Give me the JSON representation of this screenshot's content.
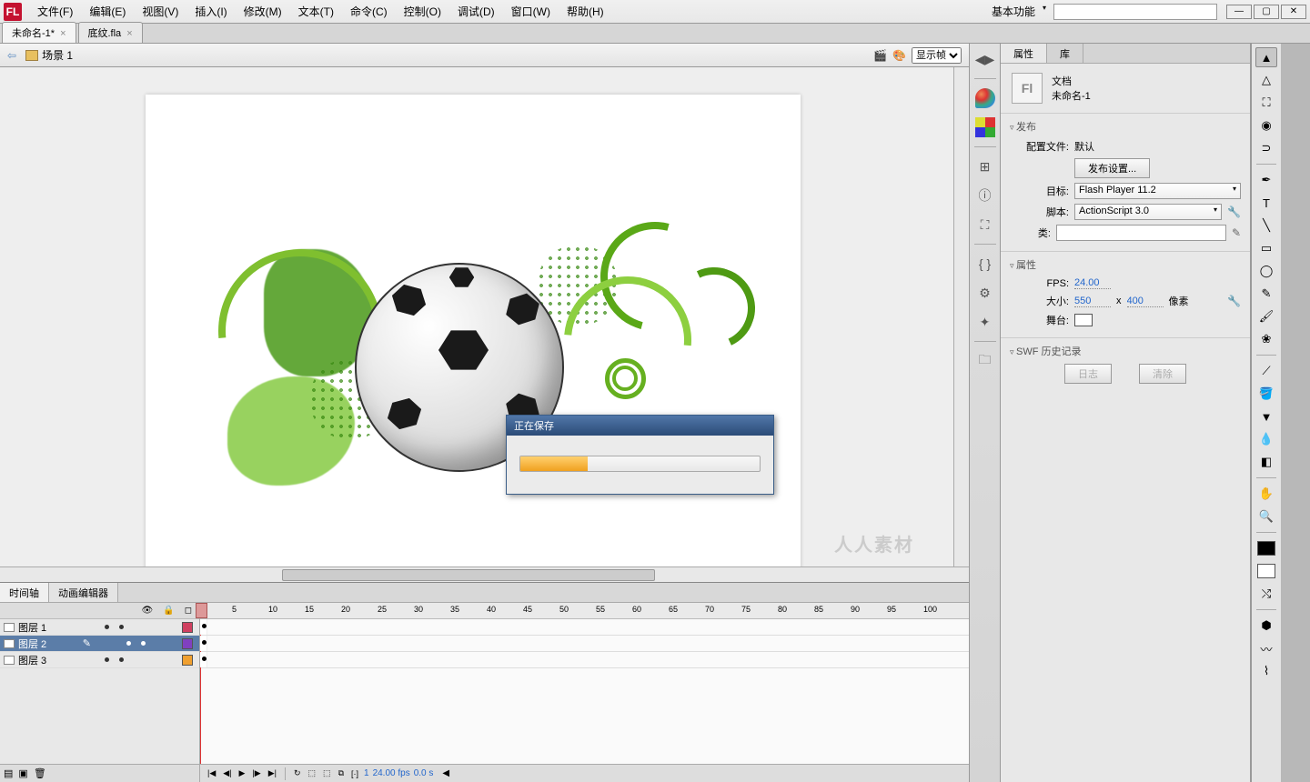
{
  "menubar": {
    "items": [
      "文件(F)",
      "编辑(E)",
      "视图(V)",
      "插入(I)",
      "修改(M)",
      "文本(T)",
      "命令(C)",
      "控制(O)",
      "调试(D)",
      "窗口(W)",
      "帮助(H)"
    ],
    "workspace": "基本功能",
    "search_placeholder": ""
  },
  "doc_tabs": [
    {
      "label": "未命名-1*",
      "active": true
    },
    {
      "label": "底纹.fla",
      "active": false
    }
  ],
  "scenebar": {
    "scene": "场景 1",
    "display_option": "显示帧"
  },
  "saving_dialog": {
    "title": "正在保存",
    "progress_pct": 28
  },
  "timeline": {
    "tabs": [
      "时间轴",
      "动画编辑器"
    ],
    "active_tab": 0,
    "layers": [
      {
        "name": "图层 1",
        "selected": false,
        "color": "#d04060"
      },
      {
        "name": "图层 2",
        "selected": true,
        "color": "#8040c0"
      },
      {
        "name": "图层 3",
        "selected": false,
        "color": "#f0a030"
      }
    ],
    "ruler_marks": [
      1,
      5,
      10,
      15,
      20,
      25,
      30,
      35,
      40,
      45,
      50,
      55,
      60,
      65,
      70,
      75,
      80,
      85,
      90,
      95,
      100
    ],
    "status": {
      "frame": 1,
      "fps_display": "24.00 fps",
      "time_display": "0.0 s"
    }
  },
  "properties": {
    "tabs": [
      "属性",
      "库"
    ],
    "active_tab": 0,
    "doc_type": "文档",
    "doc_name": "未命名-1",
    "publish": {
      "title": "发布",
      "profile_label": "配置文件:",
      "profile_value": "默认",
      "settings_button": "发布设置...",
      "target_label": "目标:",
      "target_value": "Flash Player 11.2",
      "script_label": "脚本:",
      "script_value": "ActionScript 3.0",
      "class_label": "类:",
      "class_value": ""
    },
    "props": {
      "title": "属性",
      "fps_label": "FPS:",
      "fps_value": "24.00",
      "size_label": "大小:",
      "width": "550",
      "height": "400",
      "unit": "像素",
      "stage_label": "舞台:"
    },
    "swf": {
      "title": "SWF 历史记录",
      "log_button": "日志",
      "clear_button": "清除"
    }
  },
  "watermark": "人人素材"
}
